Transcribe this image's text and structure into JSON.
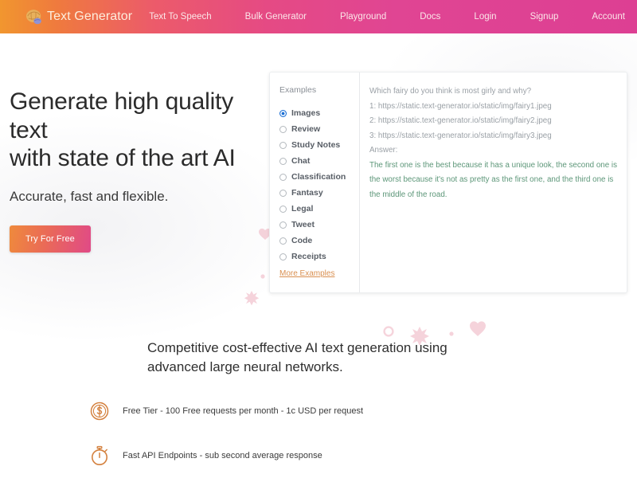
{
  "navbar": {
    "brand_label": "Text Generator",
    "brand_icon": "brain-icon",
    "links": [
      {
        "label": "Text To Speech"
      },
      {
        "label": "Bulk Generator"
      },
      {
        "label": "Playground"
      },
      {
        "label": "Docs"
      },
      {
        "label": "Login"
      },
      {
        "label": "Signup"
      },
      {
        "label": "Account"
      }
    ],
    "gradient_start": "#f1962f",
    "gradient_end": "#dd3f93"
  },
  "hero": {
    "title_line1": "Generate high quality text",
    "title_line2": "with state of the art AI",
    "subtitle": "Accurate, fast and flexible.",
    "cta_label": "Try For Free",
    "cta_gradient_start": "#ef8a3c",
    "cta_gradient_end": "#e04a87"
  },
  "examples_card": {
    "label": "Examples",
    "more_link": "More Examples",
    "selected": "Images",
    "options": [
      {
        "label": "Images",
        "selected": true
      },
      {
        "label": "Review",
        "selected": false
      },
      {
        "label": "Study Notes",
        "selected": false
      },
      {
        "label": "Chat",
        "selected": false
      },
      {
        "label": "Classification",
        "selected": false
      },
      {
        "label": "Fantasy",
        "selected": false
      },
      {
        "label": "Legal",
        "selected": false
      },
      {
        "label": "Tweet",
        "selected": false
      },
      {
        "label": "Code",
        "selected": false
      },
      {
        "label": "Receipts",
        "selected": false
      }
    ],
    "prompt_lines": [
      "Which fairy do you think is most girly and why?",
      "1: https://static.text-generator.io/static/img/fairy1.jpeg",
      "2: https://static.text-generator.io/static/img/fairy2.jpeg",
      "3: https://static.text-generator.io/static/img/fairy3.jpeg",
      "Answer:"
    ],
    "answer_text": "The first one is the best because it has a unique look, the second one is the worst because it's not as pretty as the first one, and the third one is the middle of the road.",
    "answer_color": "#5c9678",
    "selected_radio_color": "#1b6fd4"
  },
  "features": {
    "headline": "Competitive cost-effective AI text generation using advanced large neural networks.",
    "items": [
      {
        "icon": "dollar-circle-icon",
        "text": "Free Tier - 100 Free requests per month - 1c USD per request"
      },
      {
        "icon": "stopwatch-icon",
        "text": "Fast API Endpoints - sub second average response"
      }
    ],
    "icon_color": "#d4813f"
  }
}
